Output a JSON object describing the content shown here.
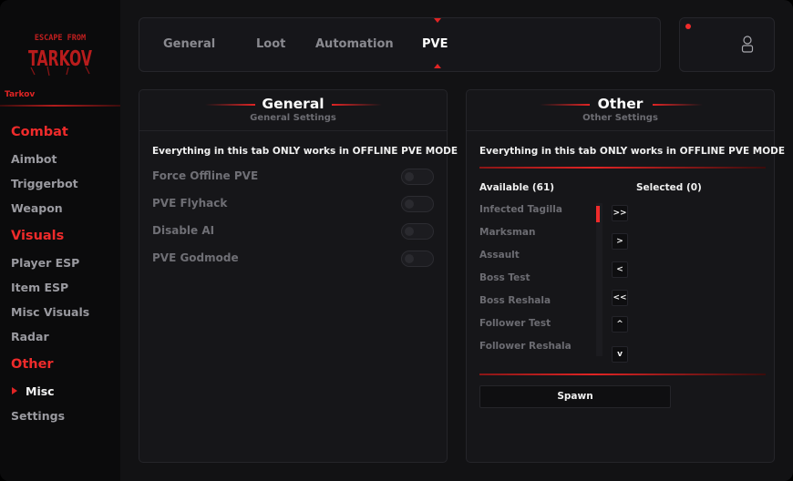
{
  "sidebar": {
    "logo_text_top": "ESCAPE FROM",
    "logo_text_main": "TARKOV",
    "brand": "Tarkov",
    "categories": {
      "combat": "Combat",
      "visuals": "Visuals",
      "other": "Other"
    },
    "items": {
      "aimbot": "Aimbot",
      "triggerbot": "Triggerbot",
      "weapon": "Weapon",
      "player_esp": "Player ESP",
      "item_esp": "Item ESP",
      "misc_visuals": "Misc Visuals",
      "radar": "Radar",
      "misc": "Misc",
      "settings": "Settings"
    }
  },
  "tabs": [
    "General",
    "Loot",
    "Automation",
    "PVE"
  ],
  "active_tab": "PVE",
  "general_panel": {
    "title": "General",
    "subtitle": "General Settings",
    "note": "Everything in this tab ONLY works in OFFLINE PVE MODE",
    "options": [
      "Force Offline PVE",
      "PVE Flyhack",
      "Disable AI",
      "PVE Godmode"
    ]
  },
  "other_panel": {
    "title": "Other",
    "subtitle": "Other Settings",
    "note": "Everything in this tab ONLY works in OFFLINE PVE MODE",
    "available_label": "Available (61)",
    "selected_label": "Selected (0)",
    "available": [
      "Infected Tagilla",
      "Marksman",
      "Assault",
      "Boss Test",
      "Boss Reshala",
      "Follower Test",
      "Follower Reshala"
    ],
    "buttons": [
      ">>",
      ">",
      "<",
      "<<",
      "^",
      "v"
    ],
    "spawn_label": "Spawn"
  },
  "colors": {
    "accent": "#e02424",
    "background": "#121214",
    "sidebar": "#0b0b0c",
    "panel": "#161619"
  },
  "icons": {
    "user": "user-icon",
    "notification": "notification-dot"
  }
}
